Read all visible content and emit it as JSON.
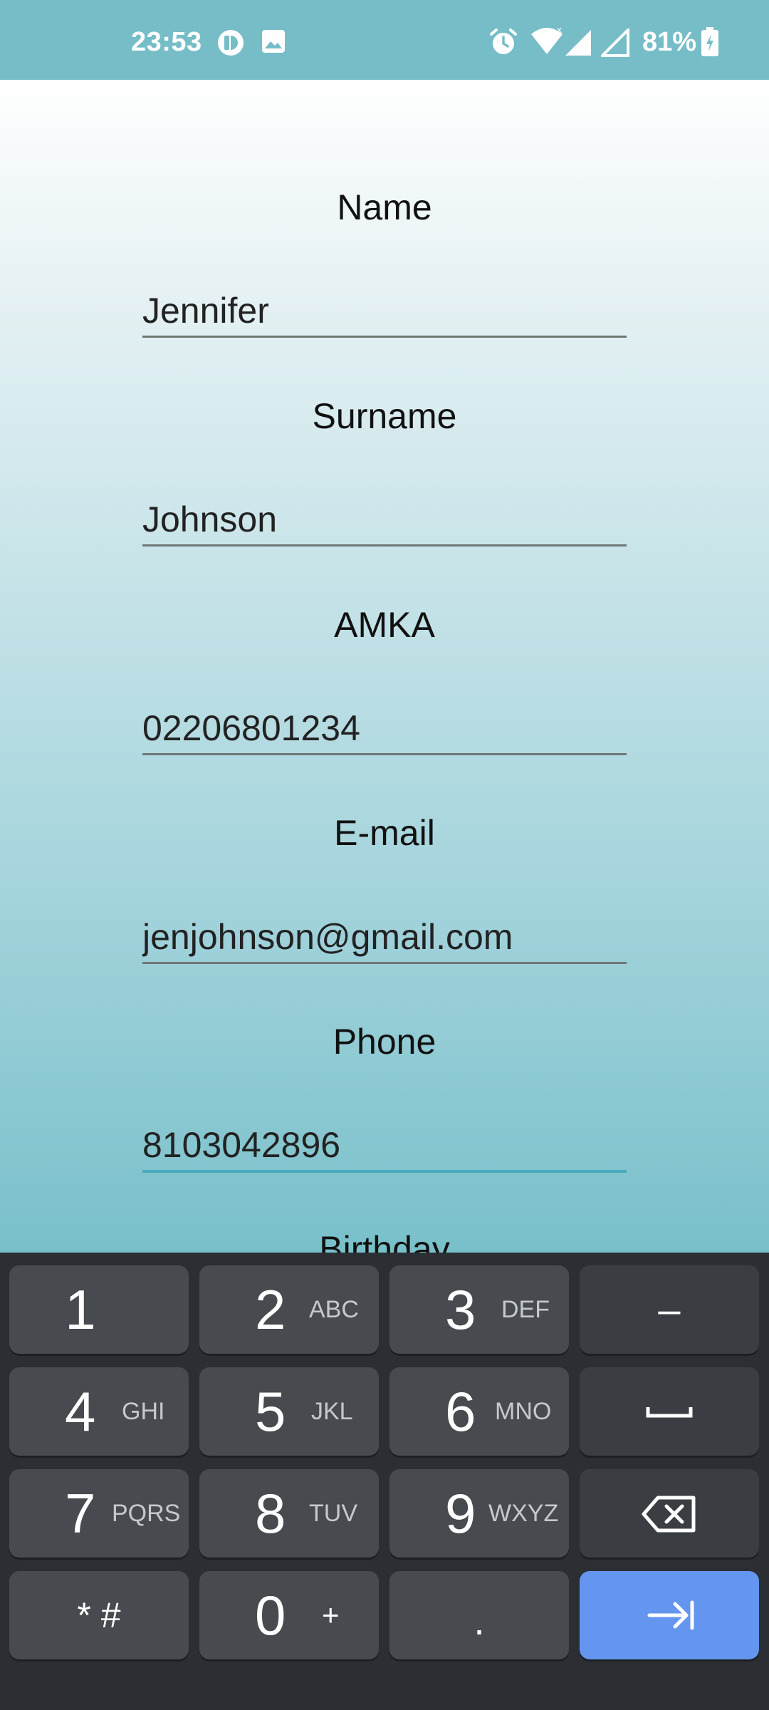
{
  "status_bar": {
    "time": "23:53",
    "battery": "81%",
    "icons": [
      "app-notification-icon",
      "image-icon",
      "alarm-icon",
      "wifi-icon",
      "signal-icon",
      "signal-icon-2",
      "battery-charging-icon"
    ]
  },
  "form": {
    "fields": [
      {
        "label": "Name",
        "value": "Jennifer"
      },
      {
        "label": "Surname",
        "value": "Johnson"
      },
      {
        "label": "AMKA",
        "value": "02206801234"
      },
      {
        "label": "E-mail",
        "value": "jenjohnson@gmail.com"
      },
      {
        "label": "Phone",
        "value": "8103042896"
      },
      {
        "label": "Birthday",
        "value": ""
      }
    ],
    "focused_field": "Phone"
  },
  "keyboard": {
    "keys": [
      {
        "num": "1",
        "letters": ""
      },
      {
        "num": "2",
        "letters": "ABC"
      },
      {
        "num": "3",
        "letters": "DEF"
      },
      {
        "num": "4",
        "letters": "GHI"
      },
      {
        "num": "5",
        "letters": "JKL"
      },
      {
        "num": "6",
        "letters": "MNO"
      },
      {
        "num": "7",
        "letters": "PQRS"
      },
      {
        "num": "8",
        "letters": "TUV"
      },
      {
        "num": "9",
        "letters": "WXYZ"
      },
      {
        "num": "0",
        "letters": "+"
      }
    ],
    "minus": "–",
    "star_hash": "* #",
    "period": ".",
    "space_icon": "space-icon",
    "backspace_icon": "backspace-icon",
    "next_icon": "tab-next-icon",
    "accent_color": "#6496f0"
  }
}
